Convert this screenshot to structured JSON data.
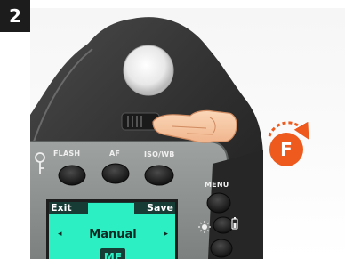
{
  "step": {
    "number": "2"
  },
  "device": {
    "buttons": {
      "flash": "FLASH",
      "af": "AF",
      "iso_wb": "ISO/WB",
      "menu": "MENU"
    },
    "lcd": {
      "left_softkey": "Exit",
      "right_softkey": "Save",
      "mode": "Manual",
      "left_arrow": "◂",
      "right_arrow": "▸",
      "focus_indicator": "MF"
    }
  },
  "indicator": {
    "letter": "F",
    "icon": "rotate-dial-icon",
    "color": "#ee5a1e"
  },
  "colors": {
    "lcd_background": "#2cf0c4",
    "device_body": "#3a3a3a",
    "panel": "#8a8e8c"
  }
}
